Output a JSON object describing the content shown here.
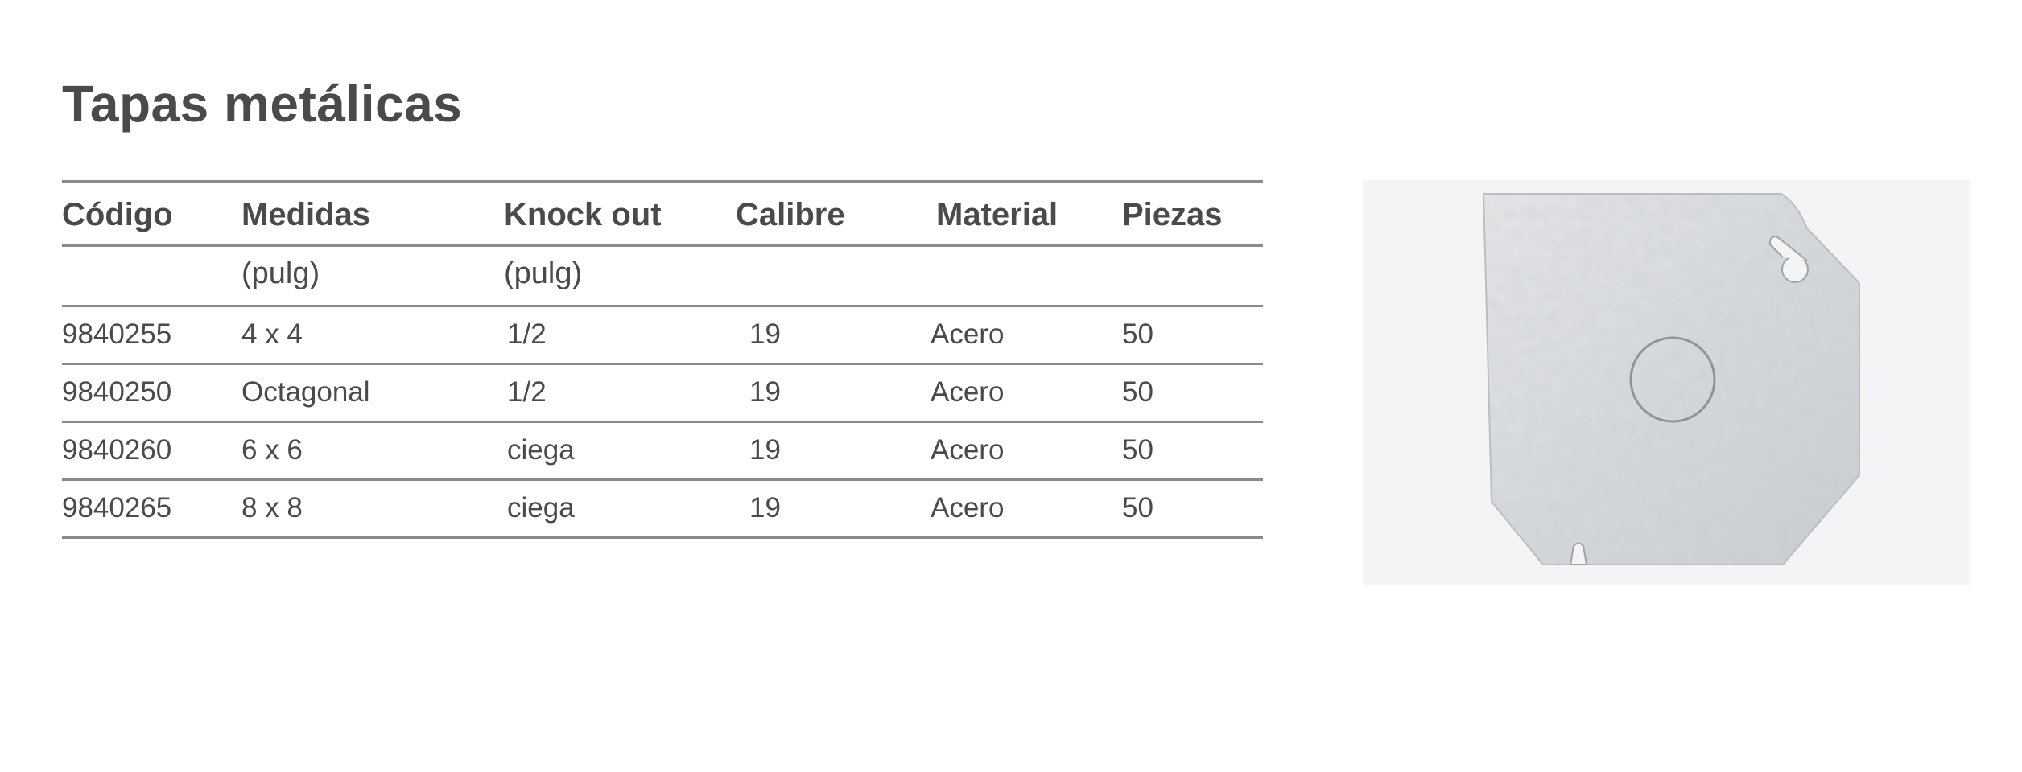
{
  "title": "Tapas metálicas",
  "table": {
    "headers": {
      "code": "Código",
      "measures": "Medidas",
      "knockout": "Knock out",
      "gauge": "Calibre",
      "material": "Material",
      "pieces": "Piezas"
    },
    "units": {
      "measures": "(pulg)",
      "knockout": "(pulg)"
    },
    "rows": [
      {
        "code": "9840255",
        "measures": "4 x 4",
        "knockout": "1/2",
        "gauge": "19",
        "material": "Acero",
        "pieces": "50"
      },
      {
        "code": "9840250",
        "measures": "Octagonal",
        "knockout": "1/2",
        "gauge": "19",
        "material": "Acero",
        "pieces": "50"
      },
      {
        "code": "9840260",
        "measures": "6 x 6",
        "knockout": "ciega",
        "gauge": "19",
        "material": "Acero",
        "pieces": "50"
      },
      {
        "code": "9840265",
        "measures": "8 x 8",
        "knockout": "ciega",
        "gauge": "19",
        "material": "Acero",
        "pieces": "50"
      }
    ]
  },
  "colors": {
    "text": "#4a4a4c",
    "rule": "#8a8a8c",
    "photo_background": "#f3f4f6",
    "metal": "#d9dcdf"
  },
  "image": {
    "subject": "octagonal-metal-cover-plate"
  }
}
